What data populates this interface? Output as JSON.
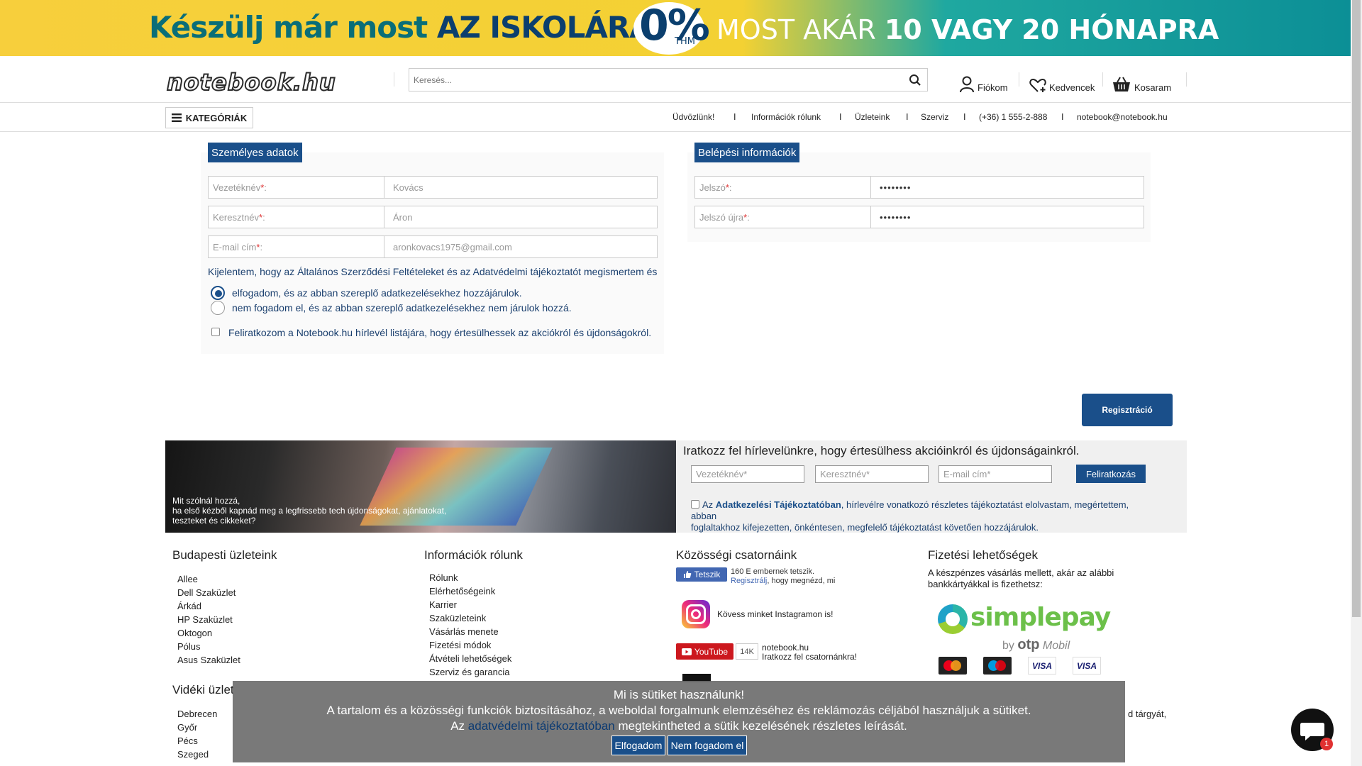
{
  "promo": {
    "left_text_a": "Készülj már most",
    "left_text_b": "AZ ISKOLÁRA",
    "percent": "0%",
    "thm": "THM",
    "right_text_a": "MOST AKÁR",
    "right_text_b": "10 VAGY 20 HÓNAPRA"
  },
  "header": {
    "logo": "notebook.hu",
    "search_placeholder": "Keresés...",
    "account": "Fiókom",
    "favorites": "Kedvencek",
    "cart": "Kosaram"
  },
  "nav": {
    "categories": "KATEGÓRIÁK",
    "items": [
      "Üdvözlünk!",
      "Információk rólunk",
      "Üzleteink",
      "Szerviz",
      "(+36) 1 555-2-888",
      "notebook@notebook.hu"
    ],
    "separator": "I"
  },
  "personal": {
    "title": "Személyes adatok",
    "lastname_label": "Vezetéknév",
    "lastname_value": "Kovács",
    "firstname_label": "Keresztnév",
    "firstname_value": "Áron",
    "email_label": "E-mail cím",
    "email_value": "aronkovacs1975@gmail.com",
    "req": "*",
    "colon": ":"
  },
  "login": {
    "title": "Belépési információk",
    "password_label": "Jelszó",
    "password_value": "••••••••",
    "password2_label": "Jelszó újra",
    "password2_value": "••••••••"
  },
  "consent": {
    "intro": "Kijelentem, hogy az Általános Szerződési Feltételeket és az Adatvédelmi tájékoztatót megismertem és",
    "accept": "elfogadom, és az abban szereplő adatkezelésekhez hozzájárulok.",
    "decline": "nem fogadom el, és az abban szereplő adatkezelésekhez nem járulok hozzá.",
    "selected": "accept",
    "newsletter": "Feliratkozom a Notebook.hu hírlevél listájára, hogy értesülhessek az akciókról és újdonságokról.",
    "newsletter_checked": false
  },
  "register_button": "Regisztráció",
  "newsletter": {
    "img_text_1": "Mit szólnál hozzá,",
    "img_text_2": "ha első kézből kapnád meg a legfrissebb tech újdonságokat, ajánlatokat,",
    "img_text_3": "teszteket és cikkeket?",
    "title": "Iratkozz fel hírlevelünkre, hogy értesülhess akcióinkról és újdonságainkról.",
    "lastname_ph": "Vezetéknév*",
    "firstname_ph": "Keresztnév*",
    "email_ph": "E-mail cím*",
    "button": "Feliratkozás",
    "consent_a": "Az",
    "consent_link": "Adatkezelési Tájékoztatóban",
    "consent_b": ", hírlevélre vonatkozó részletes tájékoztatást elolvastam, megértettem, abban",
    "consent_c": "foglaltakhoz kifejezetten, önkéntesen, megfelelő tájékoztatást követően hozzájárulok."
  },
  "footer": {
    "budapest_title": "Budapesti üzleteink",
    "budapest": [
      "Allee",
      "Dell Szaküzlet",
      "Árkád",
      "HP Szaküzlet",
      "Oktogon",
      "Pólus",
      "Asus Szaküzlet"
    ],
    "videk_title": "Vidéki üzlet",
    "videk": [
      "Debrecen",
      "Győr",
      "Pécs",
      "Szeged"
    ],
    "info_title": "Információk rólunk",
    "info": [
      "Rólunk",
      "Elérhetőségeink",
      "Karrier",
      "Szaküzleteink",
      "Vásárlás menete",
      "Fizetési módok",
      "Átvételi lehetőségek",
      "Szerviz és garancia"
    ],
    "social_title": "Közösségi csatornáink",
    "fb_like": "Tetszik",
    "fb_count": "160 E embernek tetszik.",
    "fb_reg_link": "Regisztrálj",
    "fb_reg_rest": ", hogy megnézd, mi",
    "instagram": "Kövess minket Instagramon is!",
    "yt_label": "YouTube",
    "yt_count": "14K",
    "yt_line1": "notebook.hu",
    "yt_line2": "Iratkozz fel csatornánkra!",
    "pay_title": "Fizetési lehetőségek",
    "pay_text": "A készpénzes vásárlás mellett, akár az alábbi bankkártyákkal is fizethetsz:",
    "simplepay": "simplepay",
    "by": "by",
    "otp": "otp",
    "mobil": "Mobil",
    "visa": "VISA",
    "partial": "d tárgyát,"
  },
  "cookie": {
    "title": "Mi is sütiket használunk!",
    "line2": "A tartalom és a közösségi funkciók biztosításához, a weboldal forgalmunk elemzéséhez és reklámozás céljából használjuk a sütiket.",
    "line3_a": "Az",
    "line3_link": "adatvédelmi tájékoztatóban",
    "line3_b": "megtekintheted a sütik kezelésének részletes leírását.",
    "accept": "Elfogadom",
    "decline": "Nem fogadom el"
  },
  "chat": {
    "badge": "1"
  },
  "colors": {
    "primary": "#1a4f8a",
    "banner_yellow": "#f7cf3c",
    "banner_teal": "#0c8f96"
  }
}
